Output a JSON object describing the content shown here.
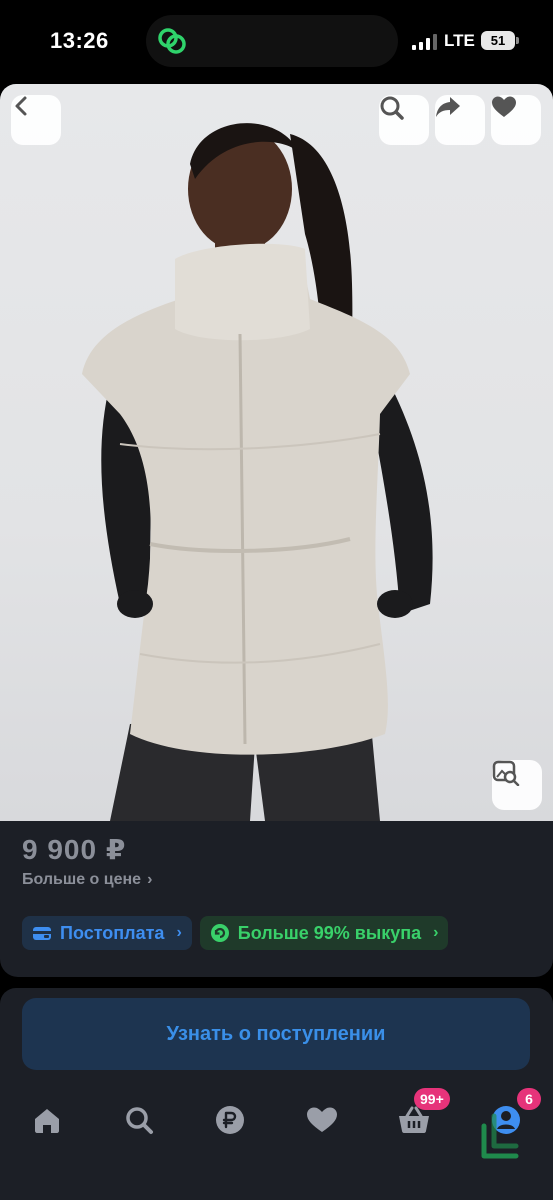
{
  "status_bar": {
    "time": "13:26",
    "network": "LTE",
    "battery": "51"
  },
  "product": {
    "price": "9 900 ₽",
    "more_price_label": "Больше о цене",
    "badges": [
      {
        "label": "Постоплата",
        "icon": "wallet-icon",
        "color": "#3e8ef0"
      },
      {
        "label": "Больше 99% выкупа",
        "icon": "return-icon",
        "color": "#39d16a"
      }
    ]
  },
  "actions": {
    "notify_label": "Узнать о поступлении"
  },
  "tabbar": {
    "items": [
      {
        "name": "home",
        "icon": "home-icon"
      },
      {
        "name": "search",
        "icon": "search-icon"
      },
      {
        "name": "payments",
        "icon": "ruble-icon"
      },
      {
        "name": "favorites",
        "icon": "heart-icon"
      },
      {
        "name": "cart",
        "icon": "basket-icon",
        "badge": "99+"
      },
      {
        "name": "profile",
        "icon": "profile-icon",
        "badge": "6"
      }
    ]
  },
  "colors": {
    "background": "#1c1f26",
    "accent_blue": "#3a8fe8",
    "accent_green": "#39d16a",
    "badge_pink": "#e6337a",
    "price_gray": "#8b8f99"
  }
}
